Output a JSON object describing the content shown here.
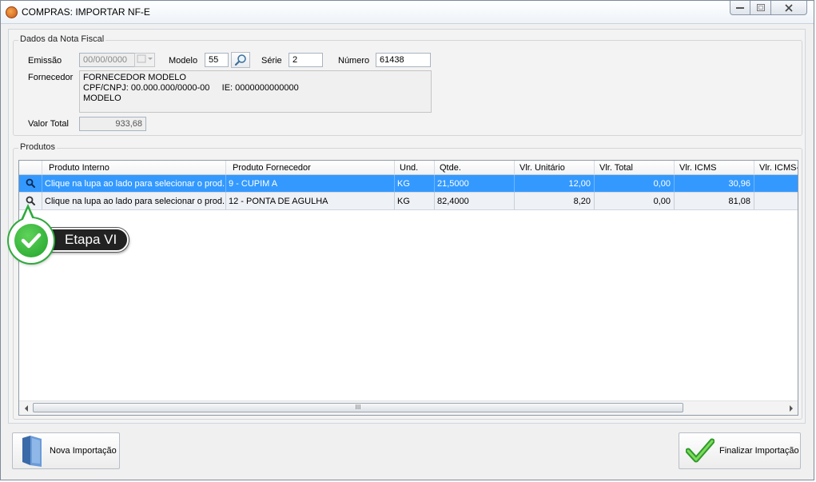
{
  "window": {
    "title": "COMPRAS: IMPORTAR NF-E"
  },
  "nota": {
    "group_label": "Dados da Nota Fiscal",
    "emissao_label": "Emissão",
    "emissao_value": "00/00/0000",
    "modelo_label": "Modelo",
    "modelo_value": "55",
    "serie_label": "Série",
    "serie_value": "2",
    "numero_label": "Número",
    "numero_value": "61438",
    "fornecedor_label": "Fornecedor",
    "fornecedor_line1": "FORNECEDOR MODELO",
    "fornecedor_line2": "CPF/CNPJ: 00.000.000/0000-00     IE: 0000000000000",
    "fornecedor_line3": "MODELO",
    "valor_total_label": "Valor Total",
    "valor_total_value": "933,68"
  },
  "produtos": {
    "group_label": "Produtos",
    "columns": [
      "Produto Interno",
      "Produto Fornecedor",
      "Und.",
      "Qtde.",
      "Vlr. Unitário",
      "Vlr. Total",
      "Vlr. ICMS",
      "Vlr. ICMS-"
    ],
    "rows": [
      {
        "interno": "Clique na lupa ao lado para selecionar o prod...",
        "fornecedor": "9 - CUPIM A",
        "und": "KG",
        "qtde": "21,5000",
        "unitario": "12,00",
        "total": "0,00",
        "icms": "30,96"
      },
      {
        "interno": "Clique na lupa ao lado para selecionar o prod...",
        "fornecedor": "12 - PONTA DE AGULHA",
        "und": "KG",
        "qtde": "82,4000",
        "unitario": "8,20",
        "total": "0,00",
        "icms": "81,08"
      }
    ],
    "scroll_grip": "III"
  },
  "callout": {
    "label": "Etapa VI"
  },
  "footer": {
    "nova_label": "Nova Importação",
    "finalizar_label": "Finalizar Importação"
  }
}
